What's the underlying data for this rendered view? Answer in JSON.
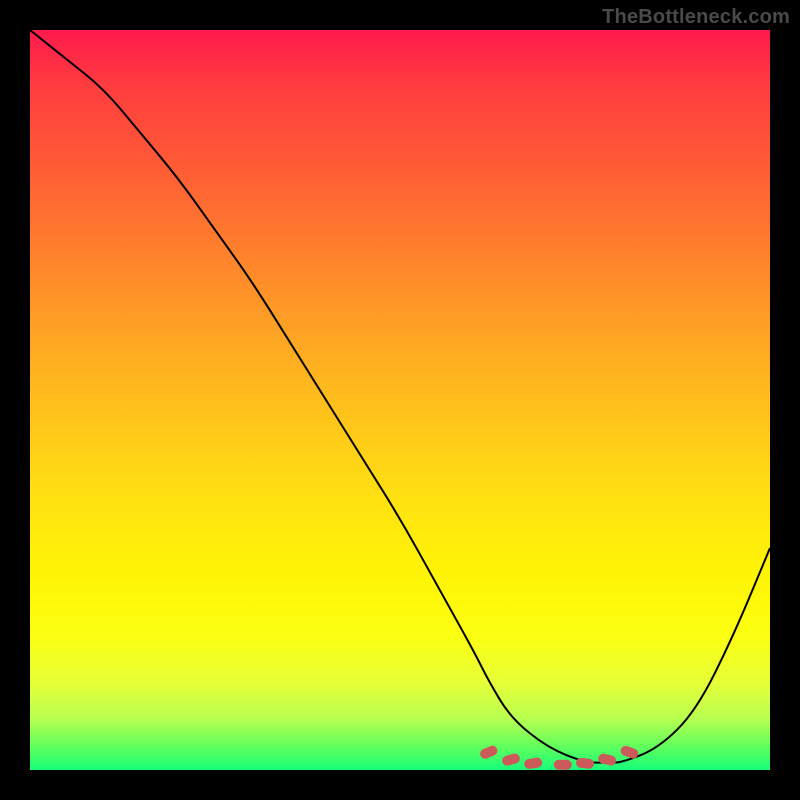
{
  "watermark": "TheBottleneck.com",
  "colors": {
    "page_bg": "#000000",
    "gradient_top": "#ff1a4d",
    "gradient_bottom": "#16ff7a",
    "curve": "#000000",
    "marker": "#cc5a5a"
  },
  "chart_data": {
    "type": "line",
    "title": "",
    "xlabel": "",
    "ylabel": "",
    "xlim": [
      0,
      100
    ],
    "ylim": [
      0,
      100
    ],
    "grid": false,
    "legend": false,
    "background": "rainbow-vertical-gradient",
    "series": [
      {
        "name": "bottleneck-curve",
        "x": [
          0,
          5,
          10,
          15,
          20,
          25,
          30,
          35,
          40,
          45,
          50,
          55,
          60,
          62,
          65,
          70,
          75,
          78,
          80,
          85,
          90,
          95,
          100
        ],
        "y": [
          100,
          96,
          92,
          86,
          80,
          73,
          66,
          58,
          50,
          42,
          34,
          25,
          16,
          12,
          7,
          3,
          1,
          1,
          1,
          3,
          8,
          18,
          30
        ]
      }
    ],
    "markers": [
      {
        "x": 62,
        "y": 2.4,
        "shape": "round-rect"
      },
      {
        "x": 65,
        "y": 1.4,
        "shape": "round-rect"
      },
      {
        "x": 68,
        "y": 0.9,
        "shape": "round-rect"
      },
      {
        "x": 72,
        "y": 0.7,
        "shape": "round-rect"
      },
      {
        "x": 75,
        "y": 0.9,
        "shape": "round-rect"
      },
      {
        "x": 78,
        "y": 1.4,
        "shape": "round-rect"
      },
      {
        "x": 81,
        "y": 2.4,
        "shape": "round-rect"
      }
    ]
  }
}
